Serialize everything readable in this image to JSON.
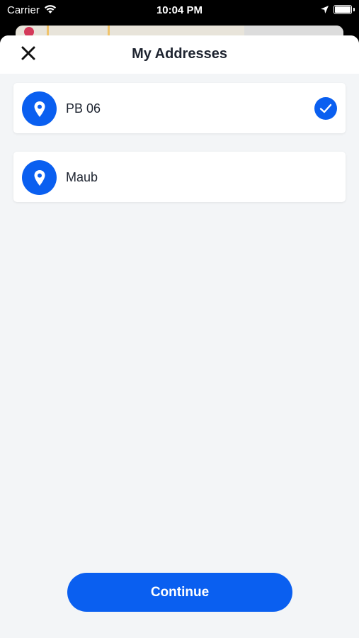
{
  "status_bar": {
    "carrier": "Carrier",
    "time": "10:04 PM",
    "icons": [
      "wifi-icon",
      "location-arrow-icon",
      "battery-icon"
    ]
  },
  "sheet": {
    "title": "My Addresses",
    "close_icon": "close-icon"
  },
  "addresses": [
    {
      "label": "PB 06",
      "icon": "map-pin-icon",
      "selected": true
    },
    {
      "label": "Maub",
      "icon": "map-pin-icon",
      "selected": false
    }
  ],
  "continue_label": "Continue",
  "colors": {
    "accent": "#0a5ff0",
    "background": "#f3f5f7",
    "card": "#ffffff",
    "text": "#1e2430"
  }
}
